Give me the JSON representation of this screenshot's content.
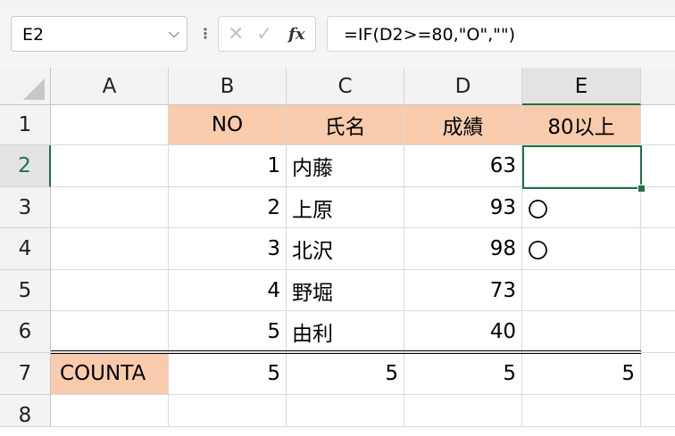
{
  "name_box": {
    "value": "E2"
  },
  "formula": {
    "text": "=IF(D2>=80,\"O\",\"\")",
    "fx_label": "fx",
    "cancel_glyph": "✕",
    "enter_glyph": "✓"
  },
  "columns": [
    "A",
    "B",
    "C",
    "D",
    "E"
  ],
  "rows": [
    "1",
    "2",
    "3",
    "4",
    "5",
    "6",
    "7",
    "8"
  ],
  "cells": {
    "B1": "NO",
    "C1": "氏名",
    "D1": "成績",
    "E1": "80以上",
    "B2": "1",
    "C2": "内藤",
    "D2": "63",
    "E2": "",
    "B3": "2",
    "C3": "上原",
    "D3": "93",
    "E3": "〇",
    "B4": "3",
    "C4": "北沢",
    "D4": "98",
    "E4": "〇",
    "B5": "4",
    "C5": "野堀",
    "D5": "73",
    "E5": "",
    "B6": "5",
    "C6": "由利",
    "D6": "40",
    "E6": "",
    "A7": "COUNTA",
    "B7": "5",
    "C7": "5",
    "D7": "5",
    "E7": "5"
  },
  "colors": {
    "header_fill": "#f8cbad",
    "selection": "#1f7246"
  }
}
